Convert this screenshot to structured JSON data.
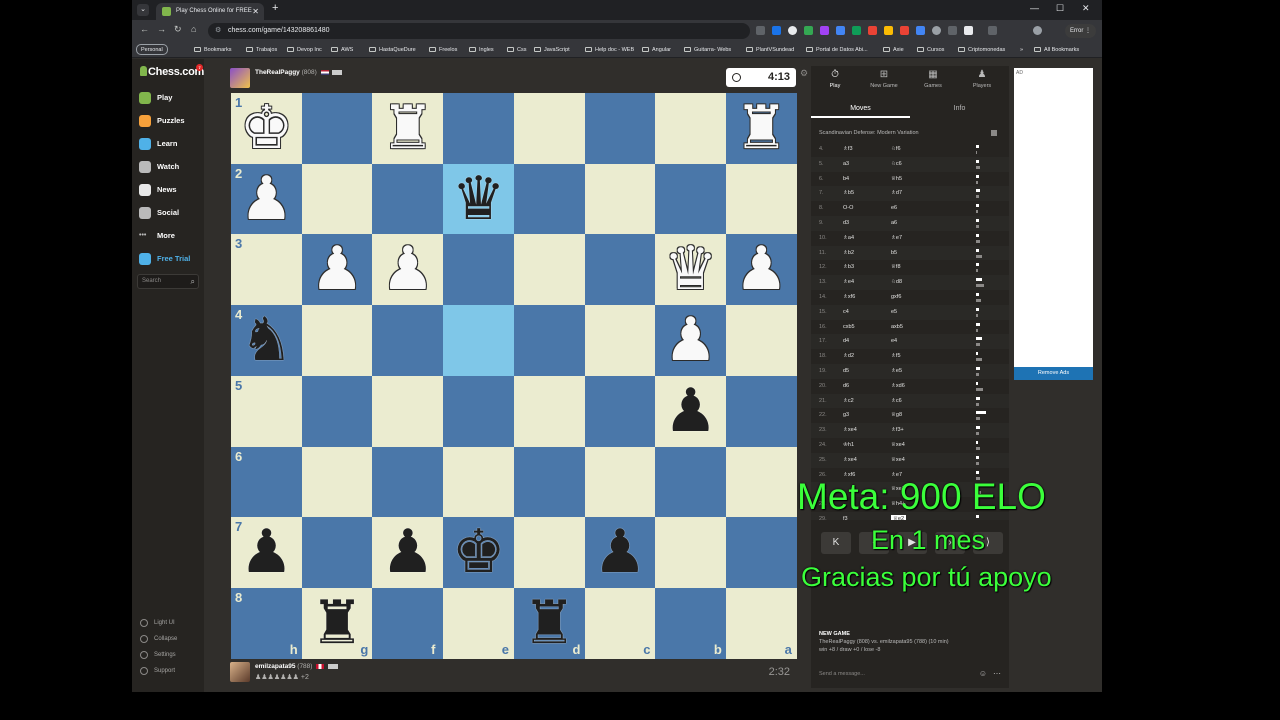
{
  "browser": {
    "tab_title": "Play Chess Online for FREE",
    "new_tab": "+",
    "tab_close": "✕",
    "tab_list": "⌄",
    "url": "chess.com/game/143208861480",
    "error_label": "Error",
    "window_min": "—",
    "window_max": "☐",
    "window_close": "✕",
    "profile_label": "Personal",
    "bookmarks": [
      "Bookmarks",
      "Trabajos",
      "Devop Inc",
      "AWS",
      "HastaQueDure",
      "Freelos",
      "Ingles",
      "Css",
      "JavaScript",
      "Help doc - WEB",
      "Angular",
      "Guitarra- Webs",
      "PlantVSundead",
      "Portal de Datos Abi...",
      "Axie",
      "Cursos",
      "Criptomonedas"
    ],
    "bookmarks_more": "»",
    "all_bookmarks": "All Bookmarks"
  },
  "sidebar": {
    "logo": "Chess.com",
    "logo_badge": "7",
    "items": [
      "Play",
      "Puzzles",
      "Learn",
      "Watch",
      "News",
      "Social",
      "More",
      "Free Trial"
    ],
    "search_placeholder": "Search",
    "bottom_items": [
      "Light UI",
      "Collapse",
      "Settings",
      "Support"
    ]
  },
  "game": {
    "top_player": {
      "name": "TheRealPaggy",
      "rating": "(808)",
      "clock": "4:13"
    },
    "bottom_player": {
      "name": "emilzapata95",
      "rating": "(788)",
      "captured": "♟♟♟♟♟♟♟ +2",
      "clock": "2:32"
    },
    "ranks": [
      "1",
      "2",
      "3",
      "4",
      "5",
      "6",
      "7",
      "8"
    ],
    "files": [
      "h",
      "g",
      "f",
      "e",
      "d",
      "c",
      "b",
      "a"
    ],
    "pieces": [
      {
        "sq": "h1",
        "glyph": "♚",
        "color": "w",
        "row": 0,
        "col": 0
      },
      {
        "sq": "f1",
        "glyph": "♜",
        "color": "w",
        "row": 0,
        "col": 2
      },
      {
        "sq": "a1",
        "glyph": "♜",
        "color": "w",
        "row": 0,
        "col": 7
      },
      {
        "sq": "h2",
        "glyph": "♟",
        "color": "w",
        "row": 1,
        "col": 0
      },
      {
        "sq": "e2",
        "glyph": "♛",
        "color": "b",
        "row": 1,
        "col": 3
      },
      {
        "sq": "g3",
        "glyph": "♟",
        "color": "w",
        "row": 2,
        "col": 1
      },
      {
        "sq": "f3",
        "glyph": "♟",
        "color": "w",
        "row": 2,
        "col": 2
      },
      {
        "sq": "b3",
        "glyph": "♛",
        "color": "w",
        "row": 2,
        "col": 6
      },
      {
        "sq": "a3",
        "glyph": "♟",
        "color": "w",
        "row": 2,
        "col": 7
      },
      {
        "sq": "h4",
        "glyph": "♞",
        "color": "b",
        "row": 3,
        "col": 0
      },
      {
        "sq": "b4",
        "glyph": "♟",
        "color": "w",
        "row": 3,
        "col": 6
      },
      {
        "sq": "b5",
        "glyph": "♟",
        "color": "b",
        "row": 4,
        "col": 6
      },
      {
        "sq": "h7",
        "glyph": "♟",
        "color": "b",
        "row": 6,
        "col": 0
      },
      {
        "sq": "f7",
        "glyph": "♟",
        "color": "b",
        "row": 6,
        "col": 2
      },
      {
        "sq": "e7",
        "glyph": "♚",
        "color": "b",
        "row": 6,
        "col": 3
      },
      {
        "sq": "c7",
        "glyph": "♟",
        "color": "b",
        "row": 6,
        "col": 5
      },
      {
        "sq": "g8",
        "glyph": "♜",
        "color": "b",
        "row": 7,
        "col": 1
      },
      {
        "sq": "d8",
        "glyph": "♜",
        "color": "b",
        "row": 7,
        "col": 4
      }
    ],
    "highlight_squares": [
      "e2",
      "e4"
    ]
  },
  "panel": {
    "tabs": [
      "Play",
      "New Game",
      "Games",
      "Players"
    ],
    "subtabs": [
      "Moves",
      "Info"
    ],
    "opening": "Scandinavian Defense: Modern Variation",
    "moves": [
      {
        "n": "4.",
        "w": "♗f3",
        "b": "♘f6"
      },
      {
        "n": "5.",
        "w": "a3",
        "b": "♘c6"
      },
      {
        "n": "6.",
        "w": "b4",
        "b": "♕h5"
      },
      {
        "n": "7.",
        "w": "♗b5",
        "b": "♗d7"
      },
      {
        "n": "8.",
        "w": "O-O",
        "b": "e6"
      },
      {
        "n": "9.",
        "w": "d3",
        "b": "a6"
      },
      {
        "n": "10.",
        "w": "♗a4",
        "b": "♗e7"
      },
      {
        "n": "11.",
        "w": "♗b2",
        "b": "b5"
      },
      {
        "n": "12.",
        "w": "♗b3",
        "b": "♕f8"
      },
      {
        "n": "13.",
        "w": "♗e4",
        "b": "♘d8"
      },
      {
        "n": "14.",
        "w": "♗xf6",
        "b": "gxf6"
      },
      {
        "n": "15.",
        "w": "c4",
        "b": "e5"
      },
      {
        "n": "16.",
        "w": "cxb5",
        "b": "axb5"
      },
      {
        "n": "17.",
        "w": "d4",
        "b": "e4"
      },
      {
        "n": "18.",
        "w": "♗d2",
        "b": "♗f5"
      },
      {
        "n": "19.",
        "w": "d5",
        "b": "♗e5"
      },
      {
        "n": "20.",
        "w": "d6",
        "b": "♗xd6"
      },
      {
        "n": "21.",
        "w": "♗c2",
        "b": "♗c6"
      },
      {
        "n": "22.",
        "w": "g3",
        "b": "♕g8"
      },
      {
        "n": "23.",
        "w": "♗xe4",
        "b": "♗f3+"
      },
      {
        "n": "24.",
        "w": "♔h1",
        "b": "♕xe4"
      },
      {
        "n": "25.",
        "w": "♗xe4",
        "b": "♕xe4"
      },
      {
        "n": "26.",
        "w": "♗xf6",
        "b": "♗e7"
      },
      {
        "n": "27.",
        "w": "",
        "b": "♕xe7"
      },
      {
        "n": "28.",
        "w": "",
        "b": "♕h4+"
      },
      {
        "n": "29.",
        "w": "f3",
        "b": "♕e2"
      }
    ],
    "controls": [
      "K",
      "‹",
      "▶",
      "›",
      "⟩"
    ],
    "new_game_title": "NEW GAME",
    "new_game_desc": "TheRealPaggy (808) vs. emilzapata95 (788) (10 min)",
    "new_game_result": "win +8 / draw +0 / lose -8",
    "chat_placeholder": "Send a message..."
  },
  "ad": {
    "label": "AD",
    "remove": "Remove Ads"
  },
  "overlay": {
    "line1": "Meta: 900 ELO",
    "line2": "En 1 mes",
    "line3": "Gracias por tú apoyo"
  },
  "colors": {
    "light_square": "#ebecd0",
    "dark_square": "#4a77a9",
    "highlight": "#7fc7e8",
    "overlay_text": "#3bff3b",
    "accent": "#81b64c"
  }
}
